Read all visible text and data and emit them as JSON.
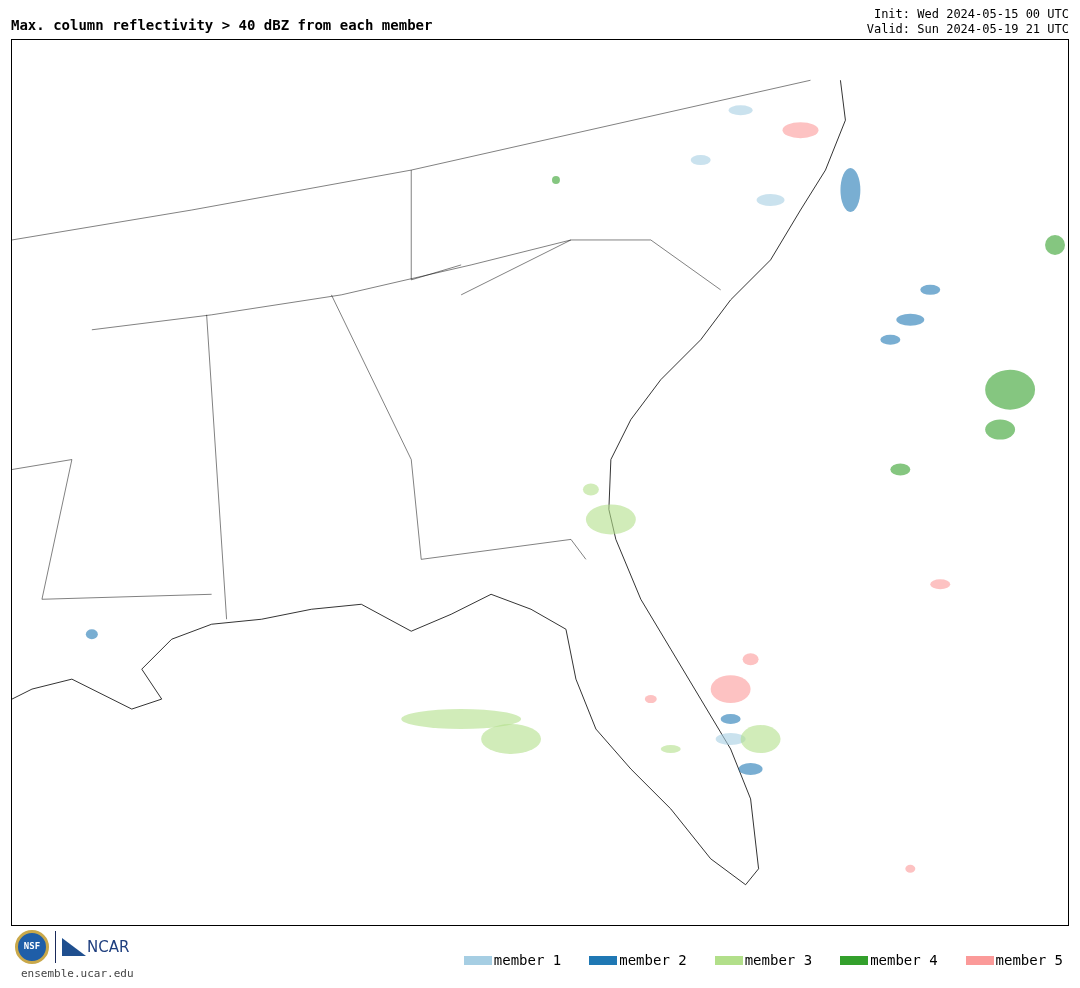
{
  "title": "Max. column reflectivity > 40 dBZ from each member",
  "run_info": [
    "Init: Wed 2024-05-15 00 UTC",
    "Valid: Sun 2024-05-19 21 UTC"
  ],
  "logos": {
    "nsf": "NSF",
    "ncar": "NCAR"
  },
  "website": "ensemble.ucar.edu",
  "legend": [
    {
      "label": "member 1",
      "color": "#a6cee3"
    },
    {
      "label": "member 2",
      "color": "#1f78b4"
    },
    {
      "label": "member 3",
      "color": "#b2df8a"
    },
    {
      "label": "member 4",
      "color": "#33a02c"
    },
    {
      "label": "member 5",
      "color": "#fb9a99"
    }
  ]
}
